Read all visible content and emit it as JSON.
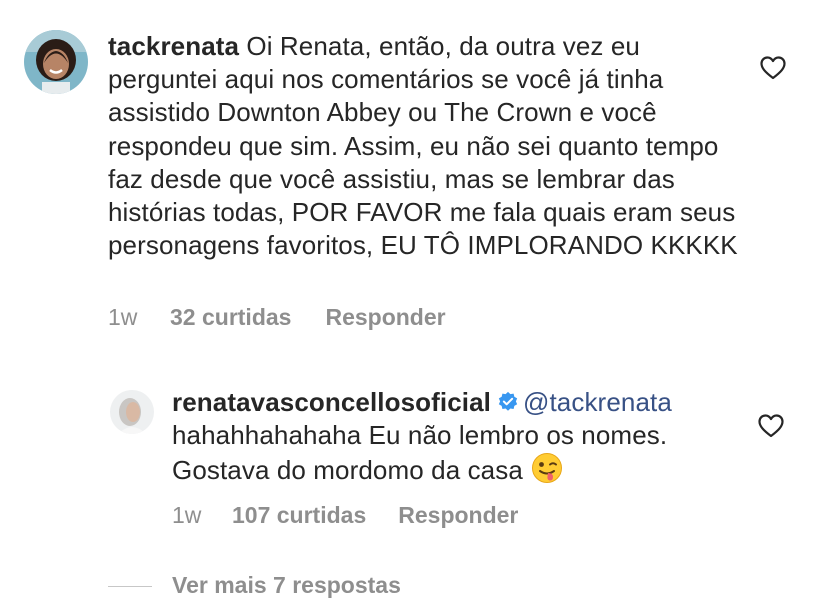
{
  "comment": {
    "username": "tackrenata",
    "text": "Oi Renata, então, da outra vez eu perguntei aqui nos comentários se você já tinha assistido Downton Abbey ou The Crown e você respondeu que sim. Assim, eu não sei quanto tempo faz desde que você assistiu, mas se lembrar das histórias todas, POR FAVOR me fala quais eram seus personagens favoritos, EU TÔ IMPLORANDO KKKKK",
    "time": "1w",
    "likes": "32 curtidas",
    "reply_label": "Responder",
    "avatar_icon": "profile-photo",
    "heart_icon": "heart-outline-icon"
  },
  "reply": {
    "username": "renatavasconcellosoficial",
    "verified_icon": "verified-badge-icon",
    "mention": "@tackrenata",
    "text": "hahahhahahaha Eu não lembro os nomes. Gostava do mordomo da casa",
    "emoji_icon": "winking-face-with-tongue-emoji",
    "time": "1w",
    "likes": "107 curtidas",
    "reply_label": "Responder",
    "heart_icon": "heart-outline-icon"
  },
  "view_more_replies": "Ver mais 7 respostas",
  "colors": {
    "text": "#262626",
    "secondary": "#8e8e8e",
    "mention": "#385185",
    "verified": "#3897f0"
  }
}
